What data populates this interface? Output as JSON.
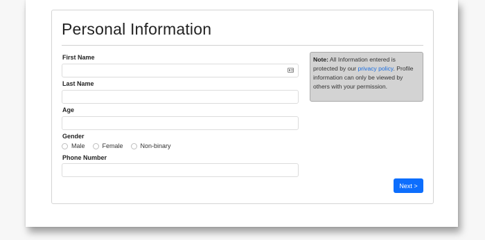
{
  "form": {
    "title": "Personal Information",
    "first_name": {
      "label": "First Name",
      "value": "",
      "placeholder": ""
    },
    "last_name": {
      "label": "Last Name",
      "value": "",
      "placeholder": ""
    },
    "age": {
      "label": "Age",
      "value": "",
      "placeholder": ""
    },
    "gender": {
      "label": "Gender",
      "options": [
        "Male",
        "Female",
        "Non-binary"
      ],
      "selected": null
    },
    "phone": {
      "label": "Phone Number",
      "value": "",
      "placeholder": ""
    },
    "next_label": "Next >"
  },
  "note": {
    "heading": "Note:",
    "text_before_link": " All Information entered is protected by our ",
    "link_text": "privacy policy",
    "text_after_link": ". Profile information can only be viewed by others with your permission."
  },
  "colors": {
    "accent": "#0d6efd",
    "link": "#1a6de0",
    "note_background": "#d3d3d3"
  }
}
